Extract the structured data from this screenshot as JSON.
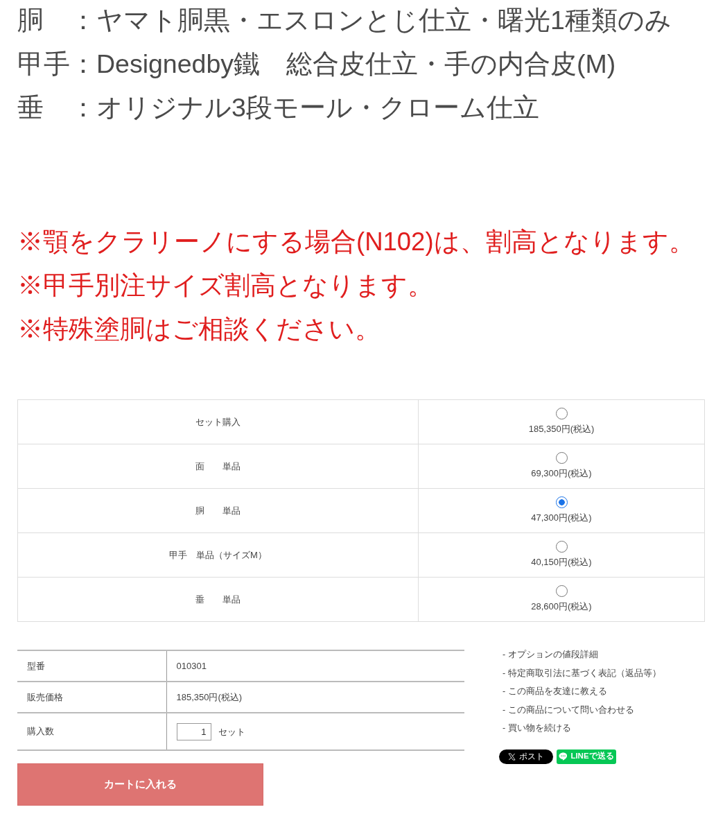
{
  "spec_lines": [
    "胴　：ヤマト胴黒・エスロンとじ仕立・曙光1種類のみ",
    "甲手：Designedby鐵　総合皮仕立・手の内合皮(M)",
    "垂　：オリジナル3段モール・クローム仕立"
  ],
  "notes": [
    "※顎をクラリーノにする場合(N102)は、割高となります。",
    "※甲手別注サイズ割高となります。",
    "※特殊塗胴はご相談ください。"
  ],
  "options": [
    {
      "label": "セット購入",
      "price": "185,350円(税込)",
      "selected": false
    },
    {
      "label": "面　　単品",
      "price": "69,300円(税込)",
      "selected": false
    },
    {
      "label": "胴　　単品",
      "price": "47,300円(税込)",
      "selected": true
    },
    {
      "label": "甲手　単品（サイズM）",
      "price": "40,150円(税込)",
      "selected": false
    },
    {
      "label": "垂　　単品",
      "price": "28,600円(税込)",
      "selected": false
    }
  ],
  "details": [
    {
      "kind": "text",
      "label": "型番",
      "value": "010301"
    },
    {
      "kind": "text",
      "label": "販売価格",
      "value": "185,350円(税込)"
    },
    {
      "kind": "quantity",
      "label": "購入数",
      "value": "1",
      "unit": "セット"
    }
  ],
  "cart_button": "カートに入れる",
  "links": [
    "- オプションの値段詳細",
    "- 特定商取引法に基づく表記（返品等）",
    "- この商品を友達に教える",
    "- この商品について問い合わせる",
    "- 買い物を続ける"
  ],
  "share_buttons": [
    {
      "kind": "x",
      "label": "ポスト"
    },
    {
      "kind": "line",
      "label": "LINEで送る"
    }
  ]
}
